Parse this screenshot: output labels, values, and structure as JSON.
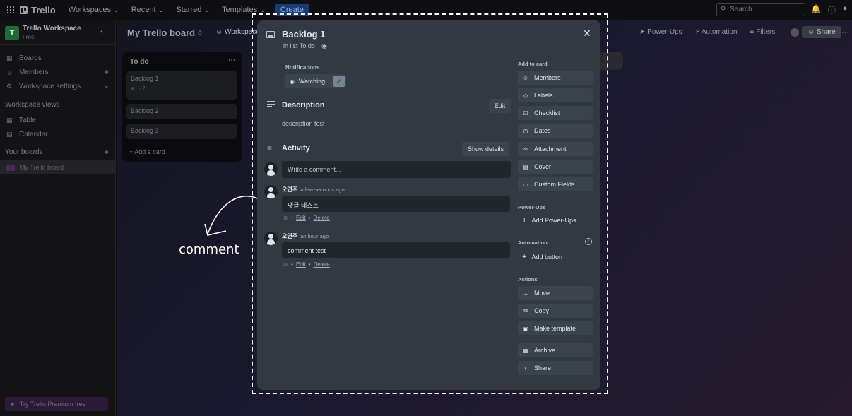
{
  "topnav": {
    "brand": "Trello",
    "menus": [
      "Workspaces",
      "Recent",
      "Starred",
      "Templates"
    ],
    "create_label": "Create",
    "search_placeholder": "Search"
  },
  "sidebar": {
    "workspace_initial": "T",
    "workspace_name": "Trello Workspace",
    "workspace_plan": "Free",
    "items": [
      "Boards",
      "Members",
      "Workspace settings"
    ],
    "views_title": "Workspace views",
    "views": [
      "Table",
      "Calendar"
    ],
    "your_boards_title": "Your boards",
    "board_name": "My Trello board",
    "premium_label": "Try Trello Premium free"
  },
  "board": {
    "title": "My Trello board",
    "visibility": "Workspace",
    "powerups": "Power-Ups",
    "automation": "Automation",
    "filters": "Filters",
    "share": "Share",
    "list": {
      "title": "To do",
      "cards": [
        {
          "title": "Backlog 1",
          "comments": "2"
        },
        {
          "title": "Backlog 2"
        },
        {
          "title": "Backlog 3"
        }
      ],
      "add_card": "Add a card"
    }
  },
  "modal": {
    "title": "Backlog 1",
    "in_list_prefix": "in list",
    "list_name": "To do",
    "notifications_label": "Notifications",
    "watching_label": "Watching",
    "description_title": "Description",
    "edit_label": "Edit",
    "description_text": "description test",
    "activity_title": "Activity",
    "show_details_label": "Show details",
    "comment_placeholder": "Write a comment...",
    "comments": [
      {
        "author": "오연주",
        "time": "a few seconds ago",
        "body": "댓글 테스트",
        "edit": "Edit",
        "delete": "Delete"
      },
      {
        "author": "오연주",
        "time": "an hour ago",
        "body": "comment test",
        "edit": "Edit",
        "delete": "Delete"
      }
    ],
    "sidebar": {
      "add_to_card_title": "Add to card",
      "add_to_card": [
        {
          "label": "Members",
          "icon": "person-icon"
        },
        {
          "label": "Labels",
          "icon": "tag-icon"
        },
        {
          "label": "Checklist",
          "icon": "checklist-icon"
        },
        {
          "label": "Dates",
          "icon": "clock-icon"
        },
        {
          "label": "Attachment",
          "icon": "paperclip-icon"
        },
        {
          "label": "Cover",
          "icon": "cover-icon"
        },
        {
          "label": "Custom Fields",
          "icon": "fields-icon"
        }
      ],
      "powerups_title": "Power-Ups",
      "add_powerups": "Add Power-Ups",
      "automation_title": "Automation",
      "add_button": "Add button",
      "actions_title": "Actions",
      "actions": [
        {
          "label": "Move",
          "icon": "arrow-right-icon"
        },
        {
          "label": "Copy",
          "icon": "copy-icon"
        },
        {
          "label": "Make template",
          "icon": "template-icon"
        },
        {
          "label": "Archive",
          "icon": "archive-icon"
        },
        {
          "label": "Share",
          "icon": "share-icon"
        }
      ]
    }
  },
  "annotation": {
    "label": "comment"
  },
  "colors": {
    "modal_bg": "#323940",
    "button_bg": "#3b444c",
    "input_bg": "#22272b",
    "annotation": "#ffffff"
  }
}
